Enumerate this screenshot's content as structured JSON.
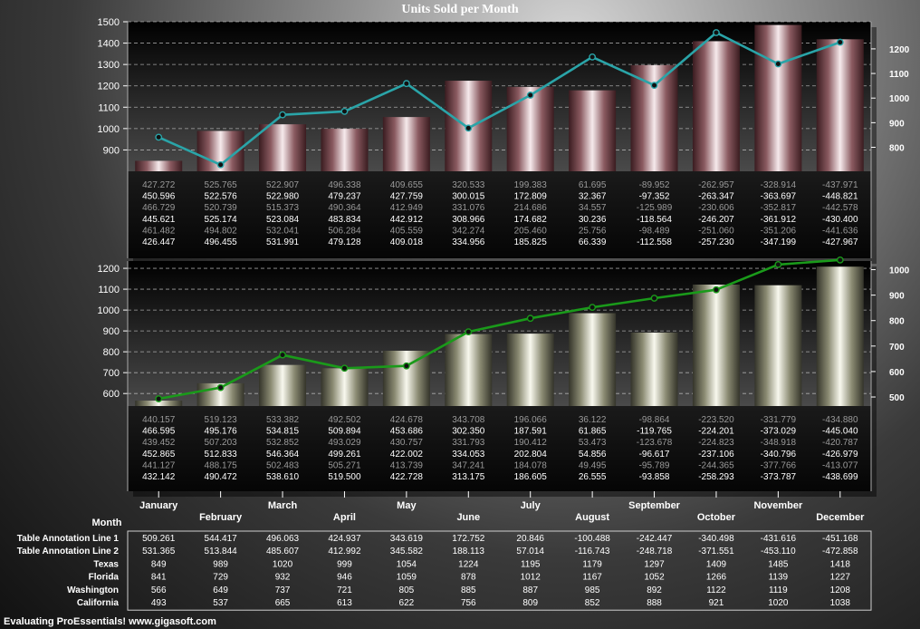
{
  "title": "Units Sold per Month",
  "footer": "Evaluating ProEssentials! www.gigasoft.com",
  "x_axis_label": "Month",
  "chart_data": [
    {
      "type": "bar",
      "panel": "top",
      "categories": [
        "January",
        "February",
        "March",
        "April",
        "May",
        "June",
        "July",
        "August",
        "September",
        "October",
        "November",
        "December"
      ],
      "series": [
        {
          "values": [
            849,
            989,
            1020,
            999,
            1054,
            1224,
            1195,
            1179,
            1297,
            1409,
            1485,
            1418
          ]
        },
        {
          "values": [
            841,
            729,
            932,
            946,
            1059,
            878,
            1012,
            1167,
            1052,
            1266,
            1139,
            1227
          ]
        }
      ],
      "ylim": [
        800,
        1500
      ],
      "yticks": [
        900,
        1000,
        1100,
        1200,
        1300,
        1400,
        1500
      ],
      "ylim_right": [
        702.4,
        1310.2
      ],
      "yticks_right": [
        800,
        900,
        1000,
        1100,
        1200
      ],
      "grid": true,
      "bar_color": "#b07a80",
      "line_color": "#2aa4a8",
      "annotation_rows": [
        [
          "427.272",
          "525.765",
          "522.907",
          "496.338",
          "409.655",
          "320.533",
          "199.383",
          "61.695",
          "-89.952",
          "-262.957",
          "-328.914",
          "-437.971"
        ],
        [
          "450.596",
          "522.576",
          "522.980",
          "479.237",
          "427.759",
          "300.015",
          "172.809",
          "32.367",
          "-97.352",
          "-263.347",
          "-363.697",
          "-448.821"
        ],
        [
          "466.729",
          "520.739",
          "515.373",
          "490.364",
          "412.949",
          "331.076",
          "214.686",
          "34.557",
          "-125.989",
          "-230.606",
          "-352.817",
          "-442.578"
        ],
        [
          "445.621",
          "525.174",
          "523.084",
          "483.834",
          "442.912",
          "308.966",
          "174.682",
          "30.236",
          "-118.564",
          "-246.207",
          "-361.912",
          "-430.400"
        ],
        [
          "461.482",
          "494.802",
          "532.041",
          "506.284",
          "405.559",
          "342.274",
          "205.460",
          "25.756",
          "-98.489",
          "-251.060",
          "-351.206",
          "-441.636"
        ],
        [
          "426.447",
          "496.455",
          "531.991",
          "479.128",
          "409.018",
          "334.956",
          "185.825",
          "66.339",
          "-112.558",
          "-257.230",
          "-347.199",
          "-427.967"
        ]
      ]
    },
    {
      "type": "bar",
      "panel": "bottom",
      "categories": [
        "January",
        "February",
        "March",
        "April",
        "May",
        "June",
        "July",
        "August",
        "September",
        "October",
        "November",
        "December"
      ],
      "series": [
        {
          "values": [
            566,
            649,
            737,
            721,
            805,
            885,
            887,
            985,
            892,
            1122,
            1119,
            1208
          ]
        },
        {
          "values": [
            493,
            537,
            665,
            613,
            622,
            756,
            809,
            852,
            888,
            921,
            1020,
            1038
          ]
        }
      ],
      "ylim": [
        540,
        1235
      ],
      "yticks": [
        600,
        700,
        800,
        900,
        1000,
        1100,
        1200
      ],
      "ylim_right": [
        464.5,
        1033.9
      ],
      "yticks_right": [
        500,
        600,
        700,
        800,
        900,
        1000
      ],
      "grid": true,
      "bar_color": "#9a9a84",
      "line_color": "#1a9a1a",
      "annotation_rows": [
        [
          "440.157",
          "519.123",
          "533.382",
          "492.502",
          "424.678",
          "343.708",
          "196.066",
          "36.122",
          "-98.864",
          "-223.520",
          "-331.779",
          "-434.880"
        ],
        [
          "466.595",
          "495.176",
          "534.815",
          "509.894",
          "453.686",
          "302.350",
          "187.591",
          "61.865",
          "-119.765",
          "-224.201",
          "-373.029",
          "-445.040"
        ],
        [
          "439.452",
          "507.203",
          "532.852",
          "493.029",
          "430.757",
          "331.793",
          "190.412",
          "53.473",
          "-123.678",
          "-224.823",
          "-348.918",
          "-420.787"
        ],
        [
          "452.865",
          "512.833",
          "546.364",
          "499.261",
          "422.002",
          "334.053",
          "202.804",
          "54.856",
          "-96.617",
          "-237.106",
          "-340.796",
          "-426.979"
        ],
        [
          "441.127",
          "488.175",
          "502.483",
          "505.271",
          "413.739",
          "347.241",
          "184.078",
          "49.495",
          "-95.789",
          "-244.365",
          "-377.766",
          "-413.077"
        ],
        [
          "432.142",
          "490.472",
          "538.610",
          "519.500",
          "422.728",
          "313.175",
          "186.605",
          "26.555",
          "-93.858",
          "-258.293",
          "-373.787",
          "-438.699"
        ]
      ]
    }
  ],
  "table": {
    "rows": [
      {
        "label": "Table Annotation Line 1",
        "values": [
          "509.261",
          "544.417",
          "496.063",
          "424.937",
          "343.619",
          "172.752",
          "20.846",
          "-100.488",
          "-242.447",
          "-340.498",
          "-431.616",
          "-451.168"
        ]
      },
      {
        "label": "Table Annotation Line 2",
        "values": [
          "531.365",
          "513.844",
          "485.607",
          "412.992",
          "345.582",
          "188.113",
          "57.014",
          "-116.743",
          "-248.718",
          "-371.551",
          "-453.110",
          "-472.858"
        ]
      },
      {
        "label": "Texas",
        "values": [
          "849",
          "989",
          "1020",
          "999",
          "1054",
          "1224",
          "1195",
          "1179",
          "1297",
          "1409",
          "1485",
          "1418"
        ]
      },
      {
        "label": "Florida",
        "values": [
          "841",
          "729",
          "932",
          "946",
          "1059",
          "878",
          "1012",
          "1167",
          "1052",
          "1266",
          "1139",
          "1227"
        ]
      },
      {
        "label": "Washington",
        "values": [
          "566",
          "649",
          "737",
          "721",
          "805",
          "885",
          "887",
          "985",
          "892",
          "1122",
          "1119",
          "1208"
        ]
      },
      {
        "label": "California",
        "values": [
          "493",
          "537",
          "665",
          "613",
          "622",
          "756",
          "809",
          "852",
          "888",
          "921",
          "1020",
          "1038"
        ]
      }
    ]
  }
}
